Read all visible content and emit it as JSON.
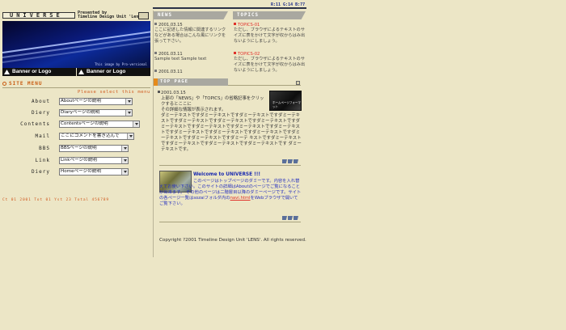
{
  "header": {
    "site_name": "UNIVERSE",
    "presented_line1": "Presented by",
    "presented_line2": "Timeline Design Unit 'Lens'",
    "hero_credit": "This image by Pro-versional",
    "rgb_readout": "R:11 G:14 B:77"
  },
  "banners": [
    {
      "label": "Banner or Logo"
    },
    {
      "label": "Banner or Logo"
    }
  ],
  "site_menu": {
    "title": "SITE MENU",
    "hint": "Please select this menu",
    "items": [
      {
        "label": "About",
        "selected": "Aboutページの説明"
      },
      {
        "label": "Diery",
        "selected": "Diaryページの説明"
      },
      {
        "label": "Contents",
        "selected": "Contentsページの説明"
      },
      {
        "label": "Mail",
        "selected": "ここにコメントを書き込んで"
      },
      {
        "label": "BBS",
        "selected": "BBSページの説明"
      },
      {
        "label": "Link",
        "selected": "Linkページの説明"
      },
      {
        "label": "Diery",
        "selected": "Homeページの説明"
      }
    ],
    "status": "Ct 01 2001   Tot 01   Yst 23   Total 456789"
  },
  "news": {
    "heading": "NEWS",
    "items": [
      {
        "date": "2001.03.15",
        "text": "ここに記述した情報に関連するリンクなどがある場合はこんな風にリンクを張って下さい。"
      },
      {
        "date": "2001.03.11",
        "text": "Sample text Sample text"
      },
      {
        "date": "2001.03.11",
        "text": ""
      }
    ]
  },
  "topics": {
    "heading": "TOPICS",
    "items": [
      {
        "date": "TOPICS-01",
        "text": "ただし、ブラウザによるテキストのサイズに表をかけて文字が収からはみ出ないようにしましょう。"
      },
      {
        "date": "TOPICS-02",
        "text": "ただし、ブラウザによるテキストのサイズに表をかけて文字が収からはみ出ないようにしましょう。"
      }
    ]
  },
  "top_page": {
    "heading": "TOP PAGE",
    "date": "2001.03.15",
    "line1": "上部の「NEWS」や「TOPICS」の省略記事をクリックするとここに",
    "line2": "その詳細な情報が表示されます。",
    "body": "ダミーテキストですダミーテキストですダミーテキストですダミーテキストですダミーテキストですダミーテキストですダミーテキストですダミーテキストですダミーテキストですダミーテキストですダミーテキストですダミーテキストですダミーテキストですダミーテキストですダミーテキストですダミーテキストですダミーテ キストですダミーテキストですダミーテキストですダミーテキストですダミーテキストです ダミーテキストです。",
    "thumb_caption": "ホームページフォーマット"
  },
  "welcome": {
    "title": "Welcome to UNIVERSE !!!",
    "body_before": "このページはトップページのダミーです。内容を入れ替えてお使い下さい。このサイトの詳細はAboutのページでご覧になることが出来ます。 その他のページは二階層目以降のダミーページです。サイトの各ページ一覧はsozaiフォルダ内の",
    "link": "navi.html",
    "body_after": "をWebブラウザで開いてご覧下さい。"
  },
  "footer": {
    "copyright": "Copyright ?2001 Timeline Design Unit 'LENS'. All rights reserved."
  }
}
